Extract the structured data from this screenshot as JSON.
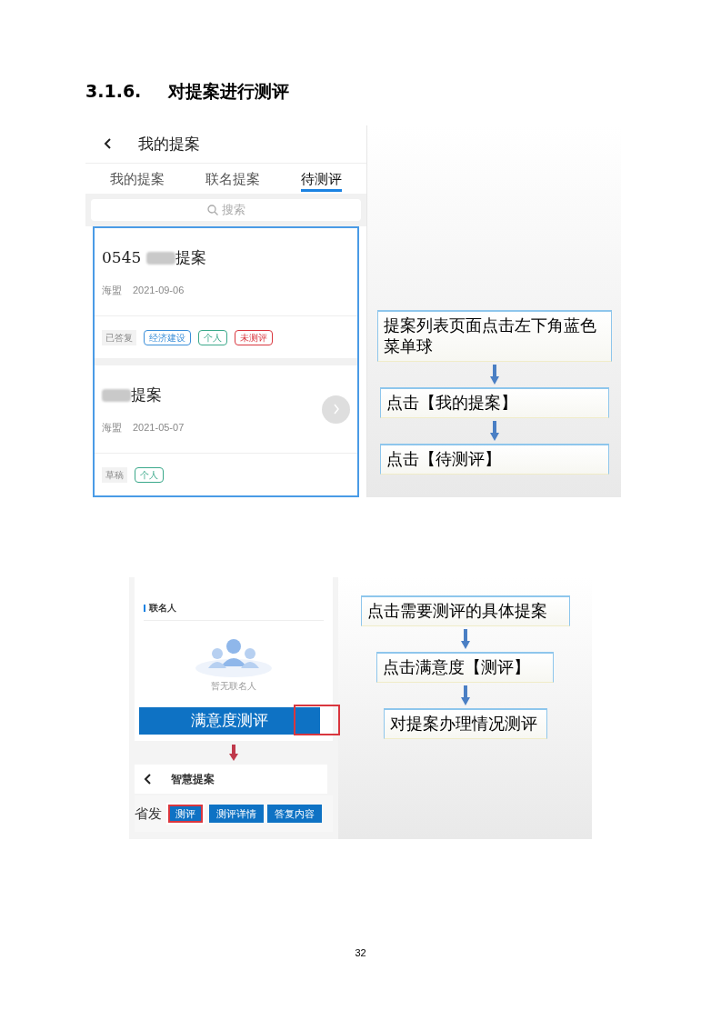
{
  "section": {
    "number": "3.1.6.",
    "title": "对提案进行测评"
  },
  "figure_1": {
    "phone": {
      "header_title": "我的提案",
      "tabs": [
        {
          "label": "我的提案",
          "selected": false
        },
        {
          "label": "联名提案",
          "selected": false
        },
        {
          "label": "待测评",
          "selected": true
        }
      ],
      "search_placeholder": "搜索",
      "cards": [
        {
          "title_prefix": "0545",
          "title_suffix": "提案",
          "org": "海盟",
          "date": "2021-09-06",
          "status": "已答复",
          "has_arrow": false,
          "tags": [
            {
              "label": "经济建设",
              "color": "#3b8fd9"
            },
            {
              "label": "个人",
              "color": "#3aa88a"
            },
            {
              "label": "未测评",
              "color": "#d9363e"
            }
          ]
        },
        {
          "title_suffix": "提案",
          "org": "海盟",
          "date": "2021-05-07",
          "status": "草稿",
          "has_arrow": true,
          "tags": [
            {
              "label": "个人",
              "color": "#3aa88a"
            }
          ]
        }
      ]
    },
    "steps": [
      "提案列表页面点击左下角蓝色菜单球",
      "点击【我的提案】",
      "点击【待测评】"
    ]
  },
  "figure_2": {
    "phone": {
      "section_label": "联名人",
      "empty_text": "暂无联名人",
      "banner": "满意度测评",
      "header_title": "智慧提案",
      "row_label": "省发",
      "buttons": [
        {
          "label": "测评",
          "highlighted": true
        },
        {
          "label": "测评详情",
          "highlighted": false
        },
        {
          "label": "答复内容",
          "highlighted": false
        }
      ]
    },
    "steps": [
      "点击需要测评的具体提案",
      "点击满意度【测评】",
      "对提案办理情况测评"
    ]
  },
  "page_number": "32"
}
